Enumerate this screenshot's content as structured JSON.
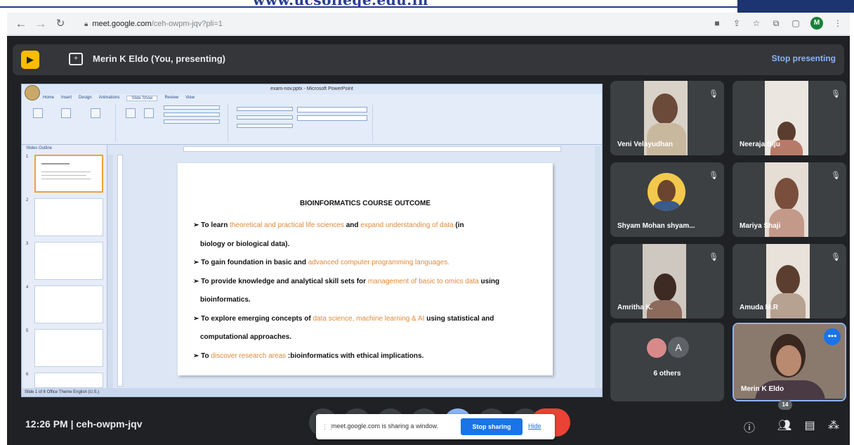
{
  "watermark": "www.ucsollege.edu.in",
  "browser": {
    "url_host": "meet.google.com",
    "url_path": "/ceh-owpm-jqv?pli=1",
    "profile_initial": "M",
    "icons": [
      "back-icon",
      "forward-icon",
      "reload-icon",
      "lock-icon",
      "camera-icon",
      "share-icon",
      "star-icon",
      "extensions-icon",
      "sidebar-icon"
    ]
  },
  "presenting_bar": {
    "text": "Merin K Eldo (You, presenting)",
    "stop_label": "Stop presenting"
  },
  "ppt": {
    "window_title": "exam-nov.pptx - Microsoft PowerPoint",
    "tabs": [
      "Home",
      "Insert",
      "Design",
      "Animations",
      "Slide Show",
      "Review",
      "View"
    ],
    "active_tab": "Slide Show",
    "panel_tabs": "Slides  Outline",
    "status": "Slide 1 of 6   Office Theme   English (U.S.)",
    "slide_numbers": [
      "1",
      "2",
      "3",
      "4",
      "5",
      "6"
    ]
  },
  "slide": {
    "title": "BIOINFORMATICS COURSE OUTCOME",
    "b1a": "➢ To learn ",
    "b1h1": "theoretical and practical life sciences",
    "b1b": " and ",
    "b1h2": "expand understanding of data",
    "b1c": " (in",
    "b1d": "biology or biological data).",
    "b2a": "➢ To gain foundation in basic and ",
    "b2h": "advanced computer programming languages.",
    "b3a": "➢ To provide knowledge and analytical skill sets for ",
    "b3h": "management of basic to omics data",
    "b3b": " using",
    "b3c": "bioinformatics.",
    "b4a": "➢ To explore emerging concepts of ",
    "b4h": "data science, machine learning & AI",
    "b4b": " using statistical and",
    "b4c": "computational approaches.",
    "b5a": "➢ To ",
    "b5h": "discover research areas",
    "b5b": " :bioinformatics with ethical implications."
  },
  "participants": [
    {
      "name": "Veni Velayudhan",
      "muted": true
    },
    {
      "name": "Neeraja Biju",
      "muted": true
    },
    {
      "name": "Shyam Mohan shyam...",
      "muted": true
    },
    {
      "name": "Mariya Shaji",
      "muted": true
    },
    {
      "name": "Amritha K.",
      "muted": true
    },
    {
      "name": "Amuda M.R",
      "muted": true
    },
    {
      "name": "6 others",
      "avatar_letter": "A"
    },
    {
      "name": "Merin K Eldo",
      "more": "•••"
    }
  ],
  "bottom": {
    "time_meeting": "12:26 PM  |  ceh-owpm-jqv",
    "share_msg": "meet.google.com is sharing a window.",
    "stop_sharing": "Stop sharing",
    "hide": "Hide",
    "people_count": "14"
  },
  "colors": {
    "meet_bg": "#202124",
    "tile_bg": "#3c4043",
    "accent_blue": "#8ab4f8",
    "highlight_orange": "#e08a3a",
    "end_red": "#ea4335"
  }
}
